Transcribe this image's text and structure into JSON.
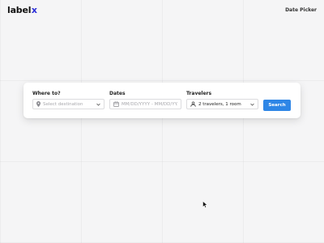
{
  "header": {
    "logo_text": "label",
    "logo_mark": "x",
    "nav_link": "Date Picker"
  },
  "search": {
    "where": {
      "label": "Where to?",
      "placeholder": "Select destination",
      "icon": "location-pin-icon"
    },
    "dates": {
      "label": "Dates",
      "placeholder": "MM/DD/YYYY - MM/DD/YY...",
      "icon": "calendar-icon"
    },
    "travelers": {
      "label": "Travelers",
      "value": "2 travelers, 1 room",
      "icon": "user-icon"
    },
    "button_label": "Search"
  },
  "colors": {
    "accent": "#2e86e6",
    "logo_mark": "#2b2fd8",
    "background": "#f5f5f6"
  }
}
